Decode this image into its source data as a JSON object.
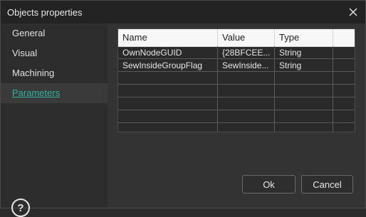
{
  "window": {
    "title": "Objects properties"
  },
  "sidebar": {
    "items": [
      {
        "label": "General"
      },
      {
        "label": "Visual"
      },
      {
        "label": "Machining"
      },
      {
        "label": "Parameters"
      }
    ],
    "active_index": 3,
    "help_label": "?"
  },
  "table": {
    "columns": [
      "Name",
      "Value",
      "Type"
    ],
    "rows": [
      [
        "OwnNodeGUID",
        "{28BFCEE...",
        "String"
      ],
      [
        "SewInsideGroupFlag",
        "SewInside...",
        "String"
      ],
      [
        "",
        "",
        ""
      ],
      [
        "",
        "",
        ""
      ],
      [
        "",
        "",
        ""
      ],
      [
        "",
        "",
        ""
      ]
    ]
  },
  "buttons": {
    "ok": "Ok",
    "cancel": "Cancel"
  },
  "colors": {
    "accent": "#2fb3a0",
    "background": "#2f2f2f"
  }
}
